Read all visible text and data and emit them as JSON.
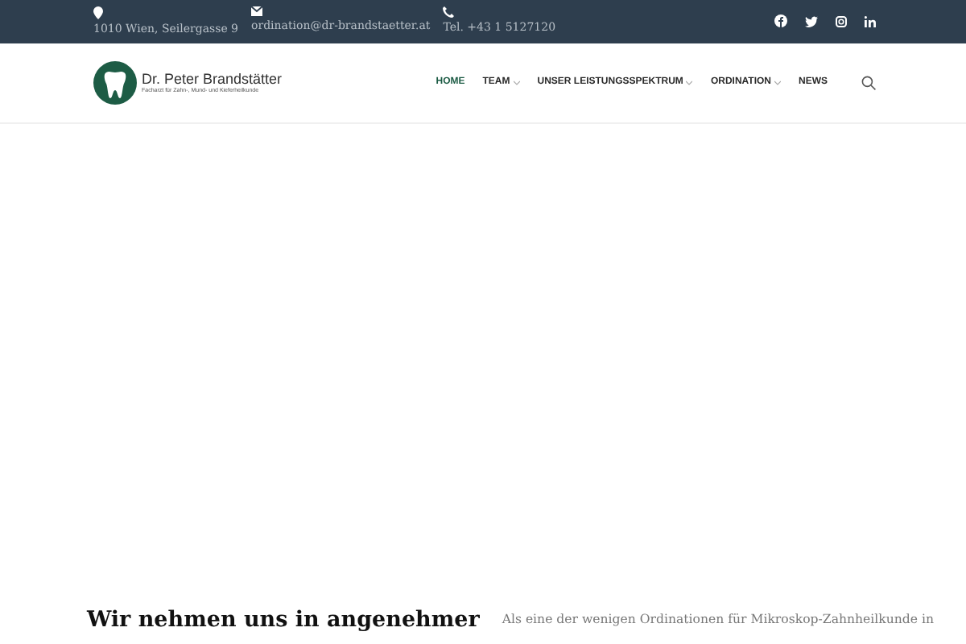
{
  "topbar": {
    "contacts": [
      {
        "kind": "pin",
        "text": "1010 Wien, Seilergasse 9"
      },
      {
        "kind": "mail",
        "text": "ordination@dr-brandstaetter.at"
      },
      {
        "kind": "phone",
        "text": "Tel. +43 1 5127120"
      }
    ],
    "social": [
      {
        "kind": "facebook"
      },
      {
        "kind": "twitter"
      },
      {
        "kind": "instagram"
      },
      {
        "kind": "linkedin"
      }
    ]
  },
  "logo": {
    "name": "Dr. Peter Brandstätter",
    "subtitle": "Facharzt für Zahn-, Mund- und Kieferheilkunde"
  },
  "nav": [
    {
      "label": "HOME",
      "selected": true,
      "dropdown": false
    },
    {
      "label": "TEAM",
      "selected": false,
      "dropdown": true
    },
    {
      "label": "UNSER LEISTUNGSSPEKTRUM",
      "selected": false,
      "dropdown": true
    },
    {
      "label": "ORDINATION",
      "selected": false,
      "dropdown": true
    },
    {
      "label": "NEWS",
      "selected": false,
      "dropdown": false
    }
  ],
  "intro": {
    "heading": "Wir nehmen uns in angenehmer",
    "text": "Als eine der wenigen Ordinationen für Mikroskop-Zahnheilkunde in"
  }
}
